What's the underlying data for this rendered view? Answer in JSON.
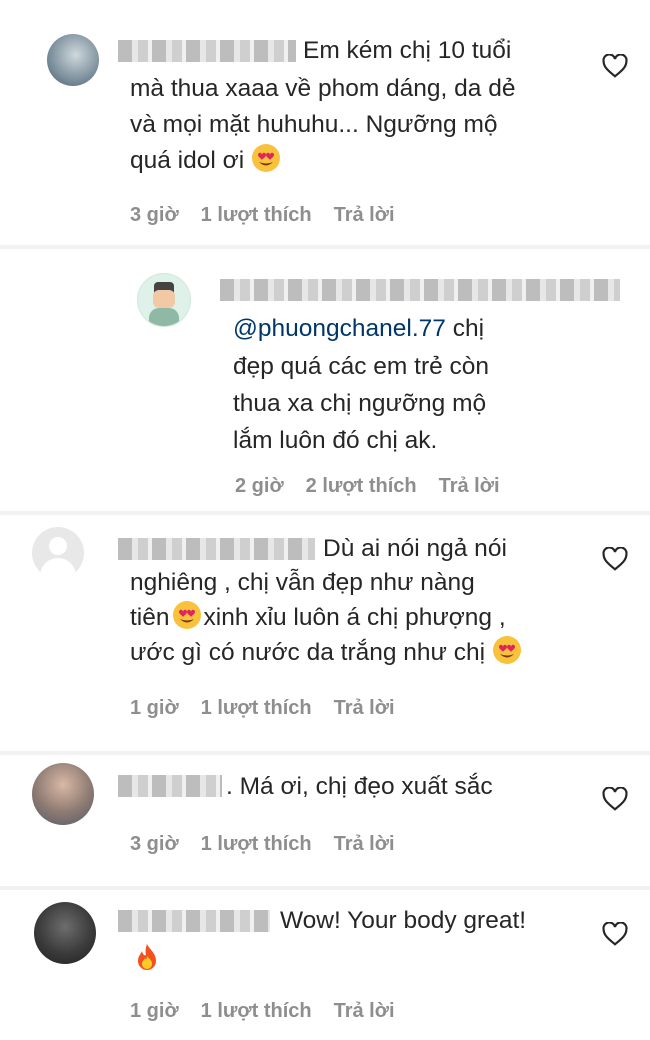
{
  "comments": [
    {
      "text": "Em kém chị 10 tuổi",
      "text_lines": [
        "mà thua xaaa về phom dáng, da dẻ",
        "và mọi mặt huhuhu... Ngưỡng mộ",
        "quá idol ơi"
      ],
      "time": "3 giờ",
      "likes": "1 lượt thích",
      "reply": "Trả lời"
    },
    {
      "mention": "@phuongchanel.77",
      "text_first": " chị",
      "text_lines": [
        "đẹp quá các em trẻ còn",
        "thua xa chị ngưỡng mộ",
        "lắm luôn đó chị ak."
      ],
      "time": "2 giờ",
      "likes": "2 lượt thích",
      "reply": "Trả lời"
    },
    {
      "text": "Dù ai nói ngả nói",
      "text_lines": [
        "nghiêng , chị vẫn đẹp như nàng",
        "xinh xỉu luôn á chị phượng ,",
        "ước gì có nước da trắng như chị"
      ],
      "line3_prefix": "tiên",
      "time": "1 giờ",
      "likes": "1 lượt thích",
      "reply": "Trả lời"
    },
    {
      "text": ". Má ơi, chị đẹo xuất sắc",
      "time": "3 giờ",
      "likes": "1 lượt thích",
      "reply": "Trả lời"
    },
    {
      "text": "Wow! Your body great!",
      "time": "1 giờ",
      "likes": "1 lượt thích",
      "reply": "Trả lời"
    }
  ],
  "icons": {
    "like": "heart-outline-icon",
    "love_emoji": "heart-eyes-emoji",
    "fire_emoji": "fire-emoji"
  },
  "colors": {
    "meta": "#8e8e8e",
    "link": "#00376b",
    "text": "#262626"
  }
}
